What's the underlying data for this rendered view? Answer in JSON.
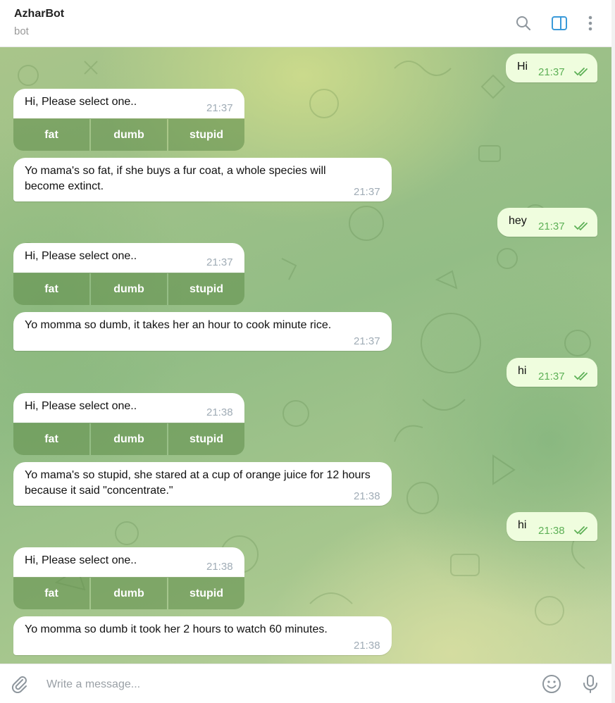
{
  "header": {
    "title": "AzharBot",
    "subtitle": "bot",
    "icons": [
      "search-icon",
      "sidebar-toggle-icon",
      "more-vertical-icon"
    ]
  },
  "messages": [
    {
      "dir": "out",
      "text": "Hi",
      "time": "21:37",
      "status": "read"
    },
    {
      "dir": "in",
      "text": "Hi, Please select one..",
      "time": "21:37",
      "buttons": [
        "fat",
        "dumb",
        "stupid"
      ]
    },
    {
      "dir": "in",
      "text": "Yo mama's so fat, if she buys a fur coat, a whole species will become extinct.",
      "time": "21:37"
    },
    {
      "dir": "out",
      "text": "hey",
      "time": "21:37",
      "status": "read"
    },
    {
      "dir": "in",
      "text": "Hi, Please select one..",
      "time": "21:37",
      "buttons": [
        "fat",
        "dumb",
        "stupid"
      ]
    },
    {
      "dir": "in",
      "text": "Yo momma so dumb, it takes her an hour to cook minute rice.",
      "time": "21:37"
    },
    {
      "dir": "out",
      "text": "hi",
      "time": "21:37",
      "status": "read"
    },
    {
      "dir": "in",
      "text": "Hi, Please select one..",
      "time": "21:38",
      "buttons": [
        "fat",
        "dumb",
        "stupid"
      ]
    },
    {
      "dir": "in",
      "text": "Yo mama's so stupid, she stared at a cup of orange juice for 12 hours because it said \"concentrate.\"",
      "time": "21:38"
    },
    {
      "dir": "out",
      "text": "hi",
      "time": "21:38",
      "status": "read"
    },
    {
      "dir": "in",
      "text": "Hi, Please select one..",
      "time": "21:38",
      "buttons": [
        "fat",
        "dumb",
        "stupid"
      ]
    },
    {
      "dir": "in",
      "text": "Yo momma so dumb it took her 2 hours to watch 60 minutes.",
      "time": "21:38"
    }
  ],
  "composer": {
    "placeholder": "Write a message...",
    "icons": [
      "attach-icon",
      "emoji-icon",
      "microphone-icon"
    ]
  },
  "colors": {
    "incoming_bubble": "#ffffff",
    "outgoing_bubble": "#effdde",
    "outgoing_time": "#5db056",
    "accent": "#3a9ad9"
  }
}
